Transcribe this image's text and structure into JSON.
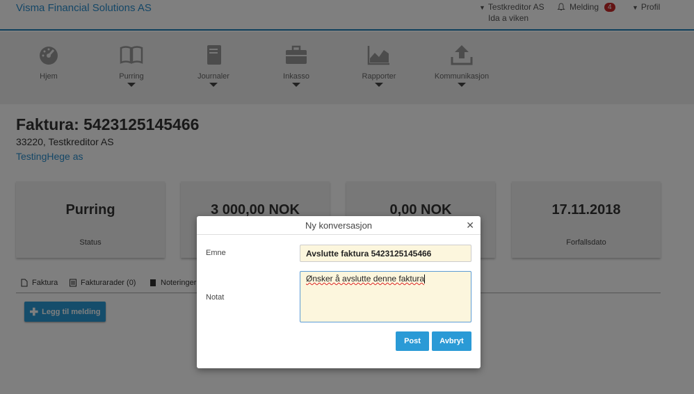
{
  "header": {
    "brand": "Visma Financial Solutions AS",
    "creditor": "Testkreditor AS",
    "user": "Ida a viken",
    "messages_label": "Melding",
    "messages_count": "4",
    "profile_label": "Profil"
  },
  "nav": {
    "items": [
      {
        "label": "Hjem",
        "icon": "dashboard-icon"
      },
      {
        "label": "Purring",
        "icon": "book-icon"
      },
      {
        "label": "Journaler",
        "icon": "journal-icon"
      },
      {
        "label": "Inkasso",
        "icon": "briefcase-icon"
      },
      {
        "label": "Rapporter",
        "icon": "chart-icon"
      },
      {
        "label": "Kommunikasjon",
        "icon": "upload-icon"
      }
    ]
  },
  "invoice": {
    "title": "Faktura: 5423125145466",
    "subtitle": "33220, Testkreditor AS",
    "debtor": "TestingHege as"
  },
  "cards": [
    {
      "value": "Purring",
      "label": "Status"
    },
    {
      "value": "3 000,00 NOK",
      "label": ""
    },
    {
      "value": "0,00 NOK",
      "label": ""
    },
    {
      "value": "17.11.2018",
      "label": "Forfallsdato"
    }
  ],
  "tabs": [
    {
      "label": "Faktura"
    },
    {
      "label": "Fakturarader (0)"
    },
    {
      "label": "Noteringer"
    }
  ],
  "add_button": "Legg til melding",
  "modal": {
    "title": "Ny konversasjon",
    "subject_label": "Emne",
    "subject_value": "Avslutte faktura 5423125145466",
    "note_label": "Notat",
    "note_value": "Ønsker å avslutte denne faktura",
    "post_label": "Post",
    "cancel_label": "Avbryt"
  },
  "colors": {
    "accent": "#2a9ad6",
    "brand": "#2a8fcf",
    "badge": "#c62828"
  }
}
